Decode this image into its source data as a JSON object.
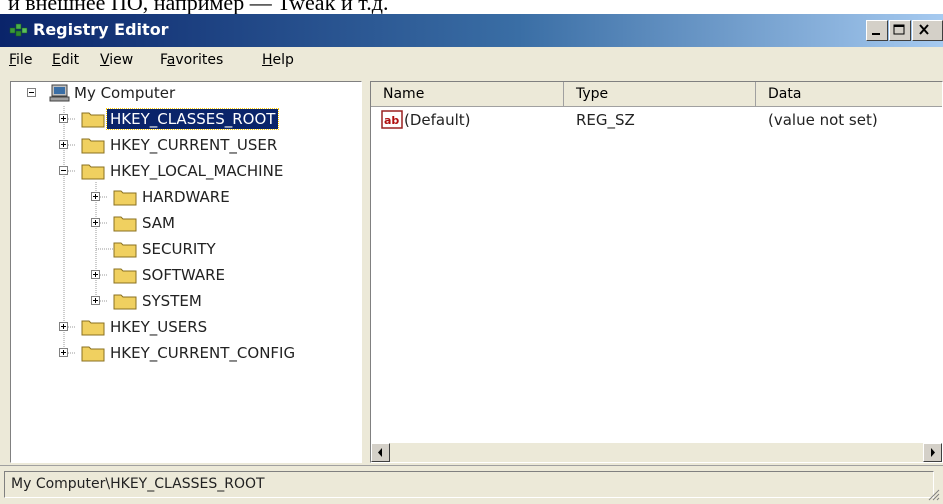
{
  "caption_fragment": "и внешнее ПО, например — Tweak и т.д.",
  "window": {
    "title": "Registry Editor",
    "icon": "registry-editor-icon",
    "controls": [
      "minimize-icon",
      "maximize-icon",
      "close-icon"
    ],
    "title_color": "#0a246a"
  },
  "menu": [
    {
      "pre": "",
      "u": "F",
      "post": "ile"
    },
    {
      "pre": "",
      "u": "E",
      "post": "dit"
    },
    {
      "pre": "",
      "u": "V",
      "post": "iew"
    },
    {
      "pre": "F",
      "u": "a",
      "post": "vorites"
    },
    {
      "pre": "",
      "u": "H",
      "post": "elp"
    }
  ],
  "tree": {
    "root": "My Computer",
    "nodes": [
      {
        "label": "HKEY_CLASSES_ROOT",
        "selected": true,
        "expander": "plus"
      },
      {
        "label": "HKEY_CURRENT_USER",
        "expander": "plus"
      },
      {
        "label": "HKEY_LOCAL_MACHINE",
        "expander": "minus"
      },
      {
        "label": "HARDWARE",
        "expander": "plus"
      },
      {
        "label": "SAM",
        "expander": "plus"
      },
      {
        "label": "SECURITY",
        "expander": "none"
      },
      {
        "label": "SOFTWARE",
        "expander": "plus"
      },
      {
        "label": "SYSTEM",
        "expander": "plus"
      },
      {
        "label": "HKEY_USERS",
        "expander": "plus"
      },
      {
        "label": "HKEY_CURRENT_CONFIG",
        "expander": "plus"
      }
    ]
  },
  "list": {
    "columns": [
      "Name",
      "Type",
      "Data"
    ],
    "rows": [
      {
        "name": "(Default)",
        "type": "REG_SZ",
        "data": "(value not set)",
        "icon": "ab-string-value-icon"
      }
    ]
  },
  "statusbar": {
    "path": "My Computer\\HKEY_CLASSES_ROOT"
  },
  "colors": {
    "selection": "#0a246a",
    "chrome": "#ece9d8",
    "folder": "#f0d060"
  }
}
